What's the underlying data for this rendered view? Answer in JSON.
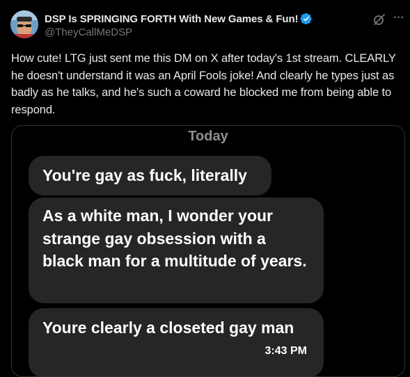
{
  "post": {
    "display_name": "DSP Is SPRINGING FORTH With New Games & Fun!",
    "handle": "@TheyCallMeDSP",
    "verified_icon": "verified-badge-icon",
    "text": "How cute! LTG just sent me this DM on X after today's 1st stream. CLEARLY he doesn't understand it was an April Fools joke! And clearly he types just as badly as he talks, and he's such a coward he blocked me from being able to respond.",
    "more_label": "···"
  },
  "screenshot": {
    "day_label": "Today",
    "messages": [
      {
        "text": "You're gay as fuck, literally"
      },
      {
        "text": "As a white man, I wonder your strange gay obsession with a black man for a multitude of years."
      },
      {
        "text": "Youre clearly a closeted gay man",
        "time": "3:43 PM"
      }
    ]
  },
  "colors": {
    "background": "#000000",
    "text_primary": "#e7e9ea",
    "text_secondary": "#71767b",
    "verified": "#1d9bf0",
    "bubble": "#262628",
    "card_border": "#2f3336"
  }
}
